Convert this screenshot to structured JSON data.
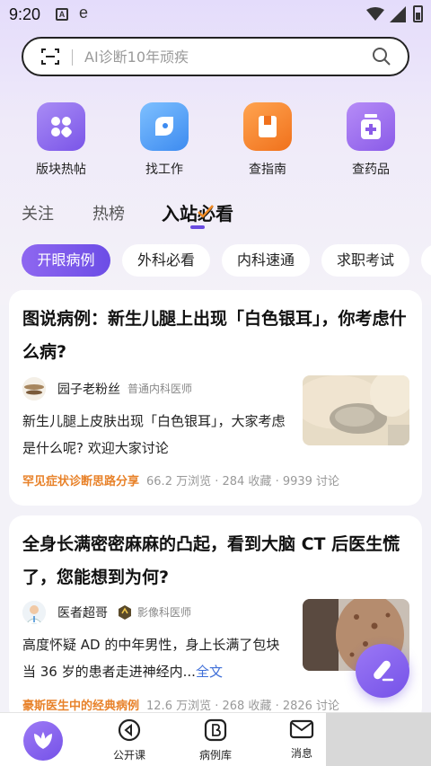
{
  "status_bar": {
    "time": "9:20",
    "app_a": "A",
    "app_e": "e"
  },
  "search": {
    "placeholder": "AI诊断10年顽疾"
  },
  "quick_actions": [
    {
      "label": "版块热帖",
      "icon": "grid-icon"
    },
    {
      "label": "找工作",
      "icon": "work-icon"
    },
    {
      "label": "查指南",
      "icon": "guide-book-icon"
    },
    {
      "label": "查药品",
      "icon": "medicine-icon"
    }
  ],
  "tabs": [
    {
      "label": "关注",
      "active": false
    },
    {
      "label": "热榜",
      "active": false
    },
    {
      "label": "入站必看",
      "active": true
    }
  ],
  "chips": [
    {
      "label": "开眼病例",
      "active": true
    },
    {
      "label": "外科必看",
      "active": false
    },
    {
      "label": "内科速通",
      "active": false
    },
    {
      "label": "求职考试",
      "active": false
    },
    {
      "label": "",
      "active": false
    }
  ],
  "posts": [
    {
      "title": "图说病例：新生儿腿上出现「白色银耳」，你考虑什么病?",
      "author": "园子老粉丝",
      "role": "普通内科医师",
      "description": "新生儿腿上皮肤出现「白色银耳」，大家考虑是什么呢? 欢迎大家讨论",
      "more_link": "",
      "tag": "罕见症状诊断思路分享",
      "stats": "66.2 万浏览 · 284 收藏 · 9939 讨论"
    },
    {
      "title": "全身长满密密麻麻的凸起，看到大脑 CT 后医生慌了，您能想到为何?",
      "author": "医者超哥",
      "role": "影像科医师",
      "description": "高度怀疑 AD 的中年男性，身上长满了包块当 36 岁的患者走进神经内...",
      "more_link": "全文",
      "tag": "豪斯医生中的经典病例",
      "stats": "12.6 万浏览 · 268 收藏 · 2826 讨论"
    }
  ],
  "fab": {
    "icon": "compose-icon"
  },
  "bottom_nav": [
    {
      "label": "",
      "icon": "home-leaf-icon"
    },
    {
      "label": "公开课",
      "icon": "play-circle-icon"
    },
    {
      "label": "病例库",
      "icon": "case-library-icon"
    },
    {
      "label": "消息",
      "icon": "mail-icon"
    }
  ],
  "colors": {
    "accent": "#6c4de6",
    "tag": "#e8822a",
    "link": "#3f6fd8"
  }
}
